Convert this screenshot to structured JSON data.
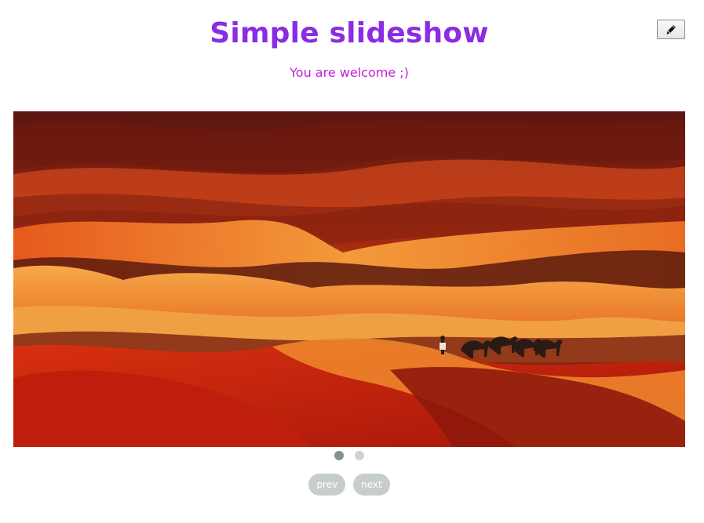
{
  "header": {
    "title": "Simple slideshow",
    "subtitle": "You are welcome ;)"
  },
  "edit_button": {
    "icon": "pencil-icon"
  },
  "slideshow": {
    "current_slide": 1,
    "slide_count": 2,
    "slide_description_icon": "desert-dunes-image",
    "controls": {
      "prev_label": "prev",
      "next_label": "next"
    }
  },
  "colors": {
    "title": "#8b2be2",
    "subtitle": "#c31fd6",
    "dot_active": "#849191",
    "dot_inactive": "#cfd3d3",
    "nav_button": "#c7cdcc"
  }
}
